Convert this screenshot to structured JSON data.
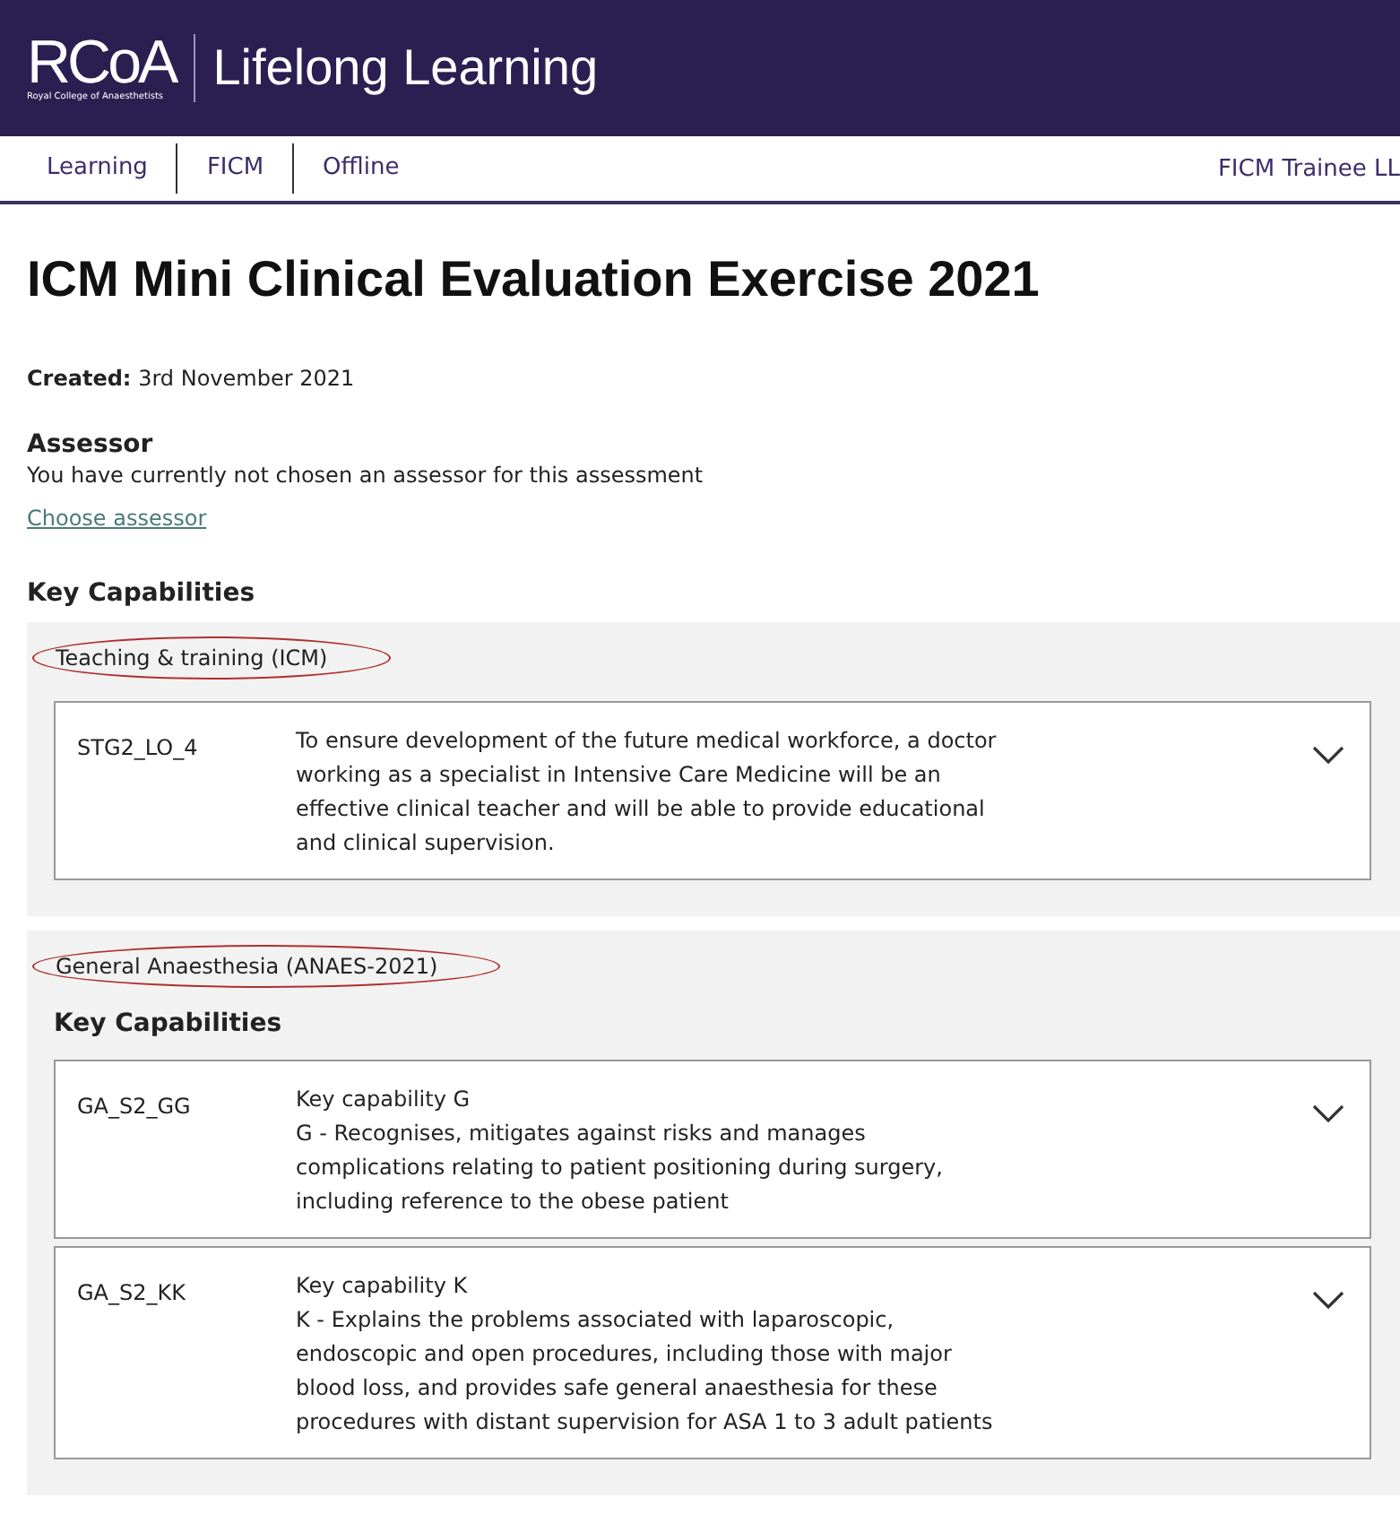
{
  "header": {
    "logo_text": "RCoA",
    "logo_subtitle": "Royal College of Anaesthetists",
    "site_title": "Lifelong Learning"
  },
  "nav": {
    "items": [
      {
        "label": "Learning"
      },
      {
        "label": "FICM"
      },
      {
        "label": "Offline"
      }
    ],
    "user": "FICM Trainee LL"
  },
  "page_title": "ICM Mini Clinical Evaluation Exercise 2021",
  "created": {
    "label": "Created:",
    "value": "3rd November 2021"
  },
  "assessor": {
    "heading": "Assessor",
    "message": "You have currently not chosen an assessor for this assessment",
    "link": "Choose assessor"
  },
  "key_capabilities_heading": "Key Capabilities",
  "sections": [
    {
      "title": "Teaching & training (ICM)",
      "items": [
        {
          "code": "STG2_LO_4",
          "description": "To ensure development of the future medical workforce, a doctor working as a specialist in Intensive Care Medicine will be an effective clinical teacher and will be able to provide educational and clinical supervision.",
          "expanded": false
        }
      ]
    },
    {
      "title": "General Anaesthesia (ANAES-2021)",
      "subheading": "Key Capabilities",
      "items": [
        {
          "code": "GA_S2_GG",
          "name": "Key capability G",
          "description": "G - Recognises, mitigates against risks and manages complications relating to patient positioning during surgery, including reference to the obese patient",
          "expanded": false
        },
        {
          "code": "GA_S2_KK",
          "name": "Key capability K",
          "description": "K - Explains the problems associated with laparoscopic, endoscopic and open procedures, including those with major blood loss, and provides safe general anaesthesia for these procedures with distant supervision for ASA 1 to 3 adult patients",
          "expanded": false
        }
      ]
    }
  ]
}
